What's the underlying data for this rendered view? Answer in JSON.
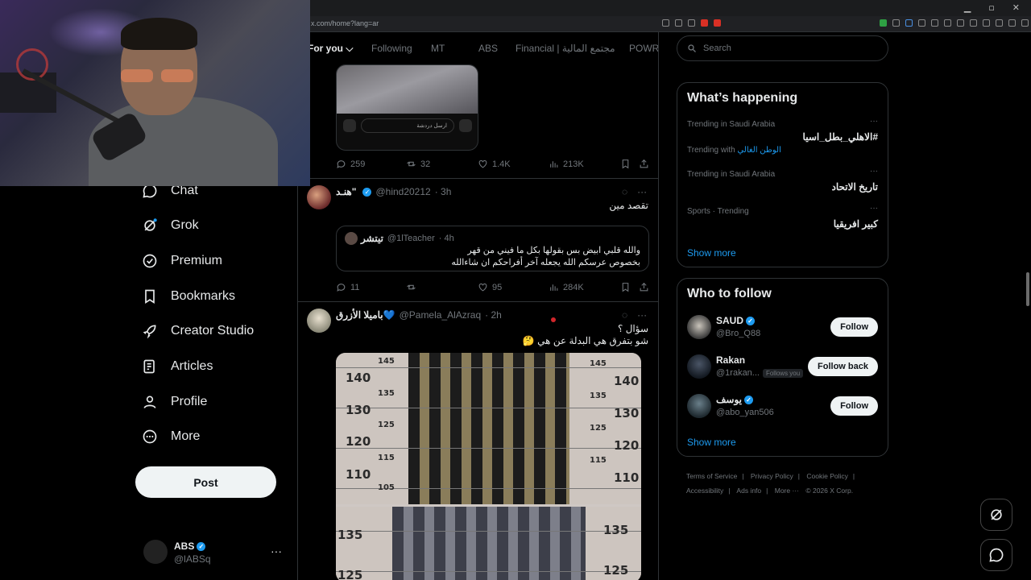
{
  "browser": {
    "url": "x.com/home?lang=ar",
    "window_controls": [
      "▁",
      "▫",
      "✕"
    ]
  },
  "tabs": [
    {
      "label": "For you",
      "active": true
    },
    {
      "label": "Following",
      "active": false
    },
    {
      "label": "MT",
      "active": false
    },
    {
      "label": "ABS",
      "active": false
    },
    {
      "label": "Financial | مجتمع المالية",
      "active": false
    },
    {
      "label": "POWR",
      "active": false
    }
  ],
  "nav": {
    "items": [
      {
        "label": "Chat",
        "icon": "chat-icon"
      },
      {
        "label": "Grok",
        "icon": "grok-icon"
      },
      {
        "label": "Premium",
        "icon": "premium-icon"
      },
      {
        "label": "Bookmarks",
        "icon": "bookmark-icon"
      },
      {
        "label": "Creator Studio",
        "icon": "rocket-icon"
      },
      {
        "label": "Articles",
        "icon": "articles-icon"
      },
      {
        "label": "Profile",
        "icon": "profile-icon"
      },
      {
        "label": "More",
        "icon": "more-icon"
      }
    ],
    "post_label": "Post",
    "account": {
      "name": "ABS",
      "handle": "@lABSq"
    }
  },
  "feed": {
    "top_tweet": {
      "media_placeholder": "ارسل دردشة",
      "replies": "259",
      "reposts": "32",
      "likes": "1.4K",
      "views": "213K"
    },
    "tweet2": {
      "name": "هنـد\"",
      "handle": "@hind20212",
      "time": "· 3h",
      "text": "تقصد مين",
      "quote": {
        "name": "تيتشر",
        "handle": "@1lTeacher",
        "time": "· 4h",
        "line1": "والله قلبي ابيض بس بقولها بكل ما فيني من قهر",
        "line2": "بخصوص عرسكم الله يجعله آخر أفراحكم ان شاءالله"
      },
      "replies": "11",
      "reposts": "",
      "likes": "95",
      "views": "284K"
    },
    "tweet3": {
      "name": "باميلا الأزرق💙",
      "handle": "@Pamela_AlAzraq",
      "time": "· 2h",
      "line1": "سؤال ؟",
      "line2": "شو بتفرق هي البدلة عن هي 🤔",
      "scale_top": [
        "145",
        "140",
        "135",
        "130",
        "125",
        "120",
        "115",
        "110",
        "105"
      ],
      "scale_bottom": [
        "135",
        "125"
      ]
    }
  },
  "right": {
    "search_placeholder": "Search",
    "happening_title": "What’s happening",
    "trends": [
      {
        "meta": "Trending in Saudi Arabia",
        "name": "#الاهلي_بطل_اسيا",
        "extra_prefix": "Trending with",
        "extra_tag": "الوطن الغالي"
      },
      {
        "meta": "Trending in Saudi Arabia",
        "name": "تاريخ الاتحاد"
      },
      {
        "meta": "Sports · Trending",
        "name": "كبير افريقيا"
      }
    ],
    "show_more": "Show more",
    "wtf_title": "Who to follow",
    "who_to_follow": [
      {
        "name": "SAUD",
        "handle": "@Bro_Q88",
        "button": "Follow",
        "verified": true
      },
      {
        "name": "Rakan",
        "handle": "@1rakan...",
        "button": "Follow back",
        "follows_you": "Follows you",
        "verified": false
      },
      {
        "name": "يوسف",
        "handle": "@abo_yan506",
        "button": "Follow",
        "verified": true
      }
    ],
    "footer": [
      "Terms of Service",
      "|",
      "Privacy Policy",
      "|",
      "Cookie Policy",
      "|",
      "Accessibility",
      "|",
      "Ads info",
      "|",
      "More ···",
      "© 2026 X Corp."
    ]
  }
}
